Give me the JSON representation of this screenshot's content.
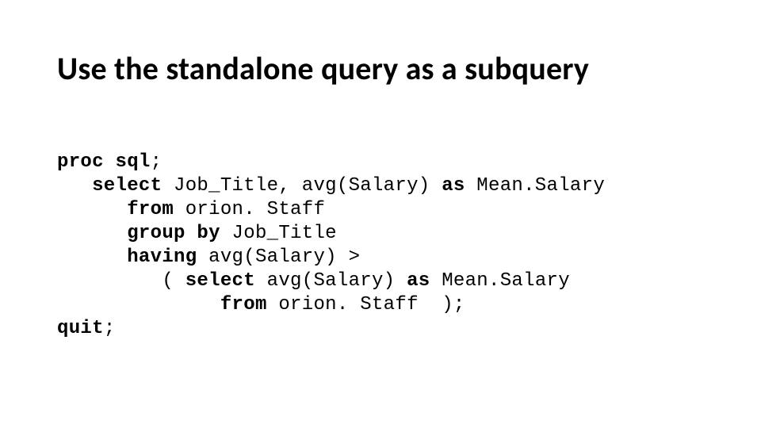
{
  "title": "Use the standalone query as a subquery",
  "code": {
    "l1a": "proc sql",
    "l1b": ";",
    "l2a": "   ",
    "l2b": "select",
    "l2c": " Job_Title, avg(Salary) ",
    "l2d": "as",
    "l2e": " Mean.Salary",
    "l3a": "      ",
    "l3b": "from",
    "l3c": " orion. Staff",
    "l4a": "      ",
    "l4b": "group by",
    "l4c": " Job_Title",
    "l5a": "      ",
    "l5b": "having",
    "l5c": " avg(Salary) >",
    "l6a": "         ( ",
    "l6b": "select",
    "l6c": " avg(Salary) ",
    "l6d": "as",
    "l6e": " Mean.Salary",
    "l7a": "              ",
    "l7b": "from",
    "l7c": " orion. Staff  );",
    "l8a": "quit",
    "l8b": ";"
  }
}
